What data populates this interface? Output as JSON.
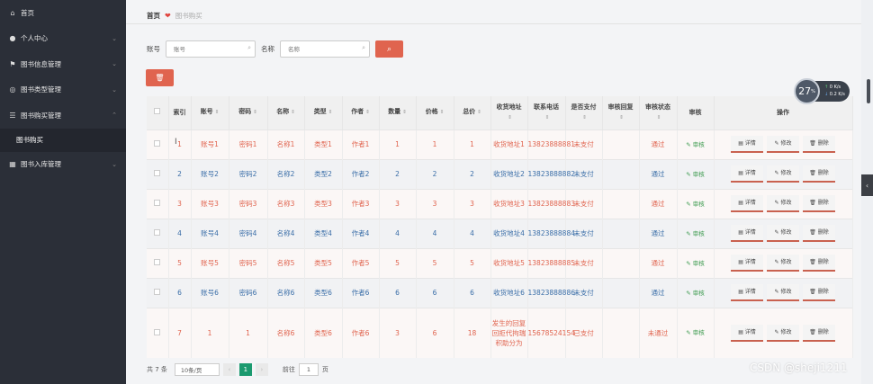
{
  "sidebar": {
    "items": [
      {
        "label": "首页",
        "icon": "home-icon",
        "glyph": "⌂",
        "chevron": false
      },
      {
        "label": "个人中心",
        "icon": "user-icon",
        "glyph": "●",
        "chevron": true
      },
      {
        "label": "图书信息管理",
        "icon": "flag-icon",
        "glyph": "⚑",
        "chevron": true
      },
      {
        "label": "图书类型管理",
        "icon": "globe-icon",
        "glyph": "◎",
        "chevron": true
      },
      {
        "label": "图书购买管理",
        "icon": "list-icon",
        "glyph": "☰",
        "chevron": true,
        "expanded": true
      }
    ],
    "submenu": "图书购买",
    "last_item": {
      "label": "图书入库管理",
      "icon": "grid-icon",
      "glyph": "▦"
    }
  },
  "breadcrumb": {
    "home": "首页",
    "current": "图书购买"
  },
  "search": {
    "account_label": "账号",
    "account_placeholder": "账号",
    "name_label": "名称",
    "name_placeholder": "名称"
  },
  "table": {
    "headers": [
      "索引",
      "账号",
      "密码",
      "名称",
      "类型",
      "作者",
      "数量",
      "价格",
      "总价",
      "收货地址",
      "联系电话",
      "是否支付",
      "审核回复",
      "审核状态",
      "审核",
      "操作"
    ],
    "audit_label": "审核",
    "ops": {
      "detail": "详情",
      "edit": "修改",
      "delete": "删除"
    },
    "rows": [
      {
        "idx": "1",
        "account": "账号1",
        "pwd": "密码1",
        "name": "名称1",
        "type": "类型1",
        "author": "作者1",
        "qty": "1",
        "price": "1",
        "total": "1",
        "addr": "收货地址1",
        "phone": "13823888881",
        "paid": "未支付",
        "reply": "",
        "status": "通过"
      },
      {
        "idx": "2",
        "account": "账号2",
        "pwd": "密码2",
        "name": "名称2",
        "type": "类型2",
        "author": "作者2",
        "qty": "2",
        "price": "2",
        "total": "2",
        "addr": "收货地址2",
        "phone": "13823888882",
        "paid": "未支付",
        "reply": "",
        "status": "通过"
      },
      {
        "idx": "3",
        "account": "账号3",
        "pwd": "密码3",
        "name": "名称3",
        "type": "类型3",
        "author": "作者3",
        "qty": "3",
        "price": "3",
        "total": "3",
        "addr": "收货地址3",
        "phone": "13823888883",
        "paid": "未支付",
        "reply": "",
        "status": "通过"
      },
      {
        "idx": "4",
        "account": "账号4",
        "pwd": "密码4",
        "name": "名称4",
        "type": "类型4",
        "author": "作者4",
        "qty": "4",
        "price": "4",
        "total": "4",
        "addr": "收货地址4",
        "phone": "13823888884",
        "paid": "未支付",
        "reply": "",
        "status": "通过"
      },
      {
        "idx": "5",
        "account": "账号5",
        "pwd": "密码5",
        "name": "名称5",
        "type": "类型5",
        "author": "作者5",
        "qty": "5",
        "price": "5",
        "total": "5",
        "addr": "收货地址5",
        "phone": "13823888885",
        "paid": "未支付",
        "reply": "",
        "status": "通过"
      },
      {
        "idx": "6",
        "account": "账号6",
        "pwd": "密码6",
        "name": "名称6",
        "type": "类型6",
        "author": "作者6",
        "qty": "6",
        "price": "6",
        "total": "6",
        "addr": "收货地址6",
        "phone": "13823888886",
        "paid": "未支付",
        "reply": "",
        "status": "通过"
      },
      {
        "idx": "7",
        "account": "1",
        "pwd": "1",
        "name": "名称6",
        "type": "类型6",
        "author": "作者6",
        "qty": "3",
        "price": "6",
        "total": "18",
        "addr": "发生的回复回拒代拘瑞积助分为",
        "phone": "15678524154",
        "paid": "已支付",
        "reply": "",
        "status": "未通过"
      }
    ]
  },
  "pager": {
    "total": "共 7 条",
    "size": "10条/页",
    "page": "1",
    "goto_prefix": "前往",
    "goto_value": "1",
    "goto_suffix": "页"
  },
  "widget": {
    "value": "27",
    "unit": "%",
    "up": "0",
    "down": "0.2",
    "up_unit": "K/s",
    "down_unit": "K/s"
  },
  "watermark": "CSDN @sheji1211",
  "colors": {
    "accent": "#e0644f",
    "link": "#3a6ea8",
    "active_page": "#1b9a6f",
    "sidebar": "#2b2f38"
  }
}
